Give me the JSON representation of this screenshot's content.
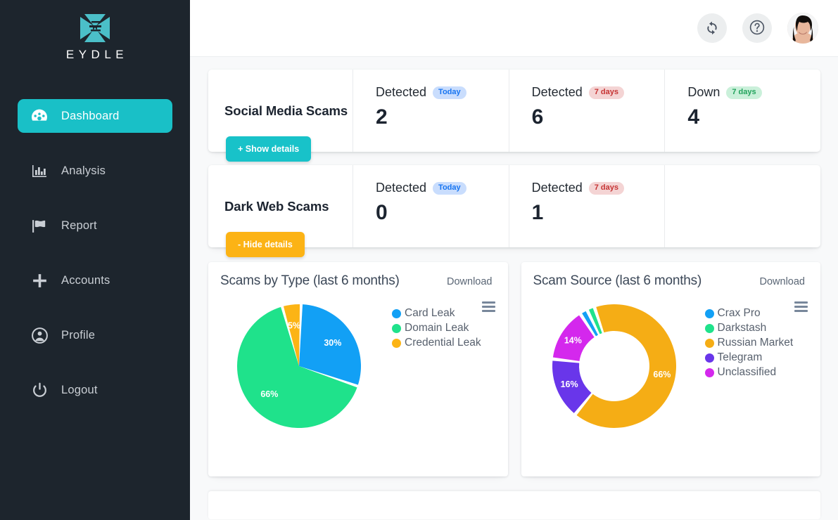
{
  "brand": {
    "name": "EYDLE",
    "logo_icon": "eydle-hourglass-logo",
    "accent_color": "#19c0c7",
    "sidebar_color": "#1d252d"
  },
  "sidebar": {
    "items": [
      {
        "label": "Dashboard",
        "icon": "gauge-icon",
        "active": true
      },
      {
        "label": "Analysis",
        "icon": "bar-chart-icon",
        "active": false
      },
      {
        "label": "Report",
        "icon": "flag-icon",
        "active": false
      },
      {
        "label": "Accounts",
        "icon": "plus-icon",
        "active": false
      },
      {
        "label": "Profile",
        "icon": "user-circle-icon",
        "active": false
      },
      {
        "label": "Logout",
        "icon": "power-icon",
        "active": false
      }
    ]
  },
  "topbar": {
    "refresh_icon": "refresh-icon",
    "help_icon": "help-circle-icon",
    "avatar_icon": "user-avatar"
  },
  "stat_cards": [
    {
      "title": "Social Media Scams",
      "cells": [
        {
          "label": "Detected",
          "badge": "Today",
          "badge_style": "today",
          "value": "2"
        },
        {
          "label": "Detected",
          "badge": "7 days",
          "badge_style": "days7-red",
          "value": "6"
        },
        {
          "label": "Down",
          "badge": "7 days",
          "badge_style": "days7-green",
          "value": "4"
        }
      ],
      "details_button": {
        "label": "+ Show details",
        "style": "teal"
      }
    },
    {
      "title": "Dark Web Scams",
      "cells": [
        {
          "label": "Detected",
          "badge": "Today",
          "badge_style": "today",
          "value": "0"
        },
        {
          "label": "Detected",
          "badge": "7 days",
          "badge_style": "days7-red",
          "value": "1"
        }
      ],
      "details_button": {
        "label": "- Hide details",
        "style": "amber"
      }
    }
  ],
  "chart_cards": [
    {
      "title": "Scams by Type (last 6 months)",
      "download_label": "Download",
      "menu_icon": "hamburger-menu-icon"
    },
    {
      "title": "Scam Source (last 6 months)",
      "download_label": "Download",
      "menu_icon": "hamburger-menu-icon"
    }
  ],
  "chart_data": [
    {
      "type": "pie",
      "title": "Scams by Type (last 6 months)",
      "xlabel": "",
      "ylabel": "",
      "legend_position": "right",
      "grid": false,
      "labels_shown": [
        "30%",
        "66%",
        "5%"
      ],
      "categories": [
        "Card Leak",
        "Domain Leak",
        "Credential Leak"
      ],
      "values": [
        30,
        66,
        5
      ],
      "colors": [
        "#12a0f5",
        "#1fe28b",
        "#fcb415"
      ],
      "slices": [
        {
          "name": "Card Leak",
          "value": 30,
          "label": "30%",
          "color": "#12a0f5"
        },
        {
          "name": "Domain Leak",
          "value": 66,
          "label": "66%",
          "color": "#1fe28b"
        },
        {
          "name": "Credential Leak",
          "value": 5,
          "label": "5%",
          "color": "#fcb415"
        }
      ]
    },
    {
      "type": "pie",
      "title": "Scam Source (last 6 months)",
      "xlabel": "",
      "ylabel": "",
      "legend_position": "right",
      "grid": false,
      "donut": true,
      "labels_shown": [
        "14%",
        "16%",
        "66%"
      ],
      "categories": [
        "Crax Pro",
        "Darkstash",
        "Russian Market",
        "Telegram",
        "Unclassified"
      ],
      "values": [
        2,
        2,
        66,
        16,
        14
      ],
      "colors": [
        "#12a0f5",
        "#1fe28b",
        "#f5ad15",
        "#6936ea",
        "#d428ed"
      ],
      "slices": [
        {
          "name": "Crax Pro",
          "value": 2,
          "label": "",
          "color": "#12a0f5"
        },
        {
          "name": "Darkstash",
          "value": 2,
          "label": "",
          "color": "#1fe28b"
        },
        {
          "name": "Russian Market",
          "value": 66,
          "label": "66%",
          "color": "#f5ad15"
        },
        {
          "name": "Telegram",
          "value": 16,
          "label": "16%",
          "color": "#6936ea"
        },
        {
          "name": "Unclassified",
          "value": 14,
          "label": "14%",
          "color": "#d428ed"
        }
      ]
    }
  ]
}
